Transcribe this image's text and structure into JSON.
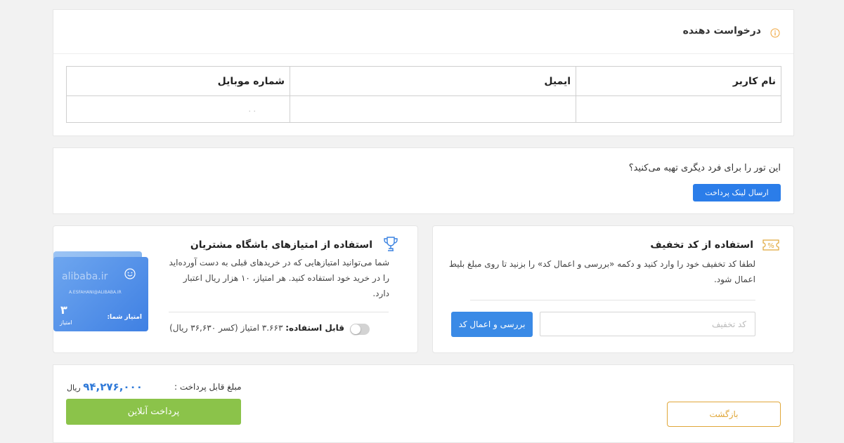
{
  "applicant": {
    "title": "درخواست دهنده",
    "table": {
      "headers": [
        "نام کاربر",
        "ایمیل",
        "شماره موبایل"
      ],
      "rows": [
        [
          "",
          "",
          ". ."
        ]
      ]
    }
  },
  "other_person": {
    "question": "این تور را برای فرد دیگری تهیه می‌کنید؟",
    "send_link_label": "ارسال لینک پرداخت"
  },
  "discount": {
    "title": "استفاده از کد تخفیف",
    "description": "لطفا کد تخفیف خود را وارد کنید و دکمه «بررسی و اعمال کد» را بزنید تا روی مبلغ بلیط اعمال شود.",
    "input_placeholder": "کد تخفیف",
    "apply_label": "بررسی و اعمال کد",
    "icon": "coupon-icon",
    "icon_text": "%"
  },
  "club": {
    "title": "استفاده از امتیازهای باشگاه مشتریان",
    "description": "شما می‌توانید امتیازهایی که در خریدهای قبلی به دست آورده‌اید را در خرید خود استفاده کنید. هر امتیاز، ۱۰ هزار ریال اعتبار دارد.",
    "usable_label": "قابل استفاده:",
    "usable_value": "۳.۶۶۳ امتیاز (کسر ۳۶,۶۳۰ ریال)",
    "toggle_on": false,
    "card": {
      "brand": "alibaba.ir",
      "email": "A.ESFAHANI@ALIBABA.IR",
      "score_label": "امتیاز شما:",
      "score": "۳",
      "score_unit": "امتیاز"
    },
    "icon": "trophy-icon"
  },
  "payment": {
    "amount_label": "مبلغ قابل پرداخت :",
    "amount": "۹۴,۲۷۶,۰۰۰",
    "currency": "ریال",
    "pay_label": "پرداخت آنلاین",
    "back_label": "بازگشت"
  },
  "colors": {
    "primary_blue": "#2b7de9",
    "pay_green": "#8bc34a",
    "back_orange": "#e0a73a",
    "amount_blue": "#2f79d8"
  }
}
